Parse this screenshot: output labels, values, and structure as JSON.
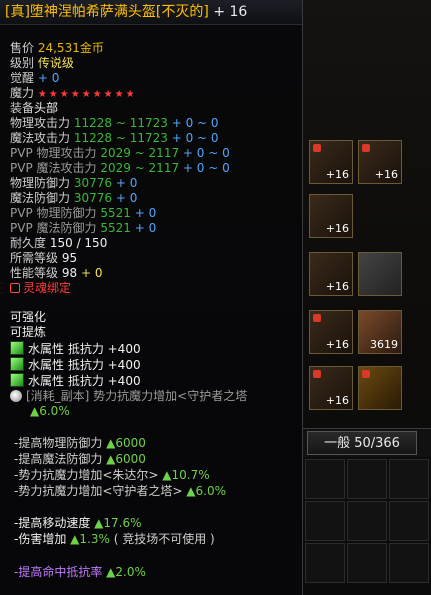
{
  "item": {
    "name": "[真]堕神涅帕希萨满头盔[不灭的]",
    "enhance": "+ 16",
    "price_label": "售价",
    "price": "24,531金币",
    "grade_label": "级别",
    "grade": "传说级",
    "awaken_label": "觉醒",
    "awaken": "+ 0",
    "magic_label": "魔力",
    "magic_stars": "★★★★★★★★★",
    "slot_label": "装备",
    "slot": "头部",
    "stats": [
      {
        "label": "物理攻击力",
        "value": "11228 ~ 11723",
        "bonus": "+ 0 ~ 0"
      },
      {
        "label": "魔法攻击力",
        "value": "11228 ~ 11723",
        "bonus": "+ 0 ~ 0"
      },
      {
        "label": "PVP 物理攻击力",
        "value": "2029 ~ 2117",
        "bonus": "+ 0 ~ 0"
      },
      {
        "label": "PVP 魔法攻击力",
        "value": "2029 ~ 2117",
        "bonus": "+ 0 ~ 0"
      },
      {
        "label": "物理防御力",
        "value": "30776",
        "bonus": "+ 0"
      },
      {
        "label": "魔法防御力",
        "value": "30776",
        "bonus": "+ 0"
      },
      {
        "label": "PVP 物理防御力",
        "value": "5521",
        "bonus": "+ 0"
      },
      {
        "label": "PVP 魔法防御力",
        "value": "5521",
        "bonus": "+ 0"
      }
    ],
    "durability_label": "耐久度",
    "durability": "150 / 150",
    "req_level_label": "所需等级",
    "req_level": "95",
    "perf_level_label": "性能等级",
    "perf_level": "98",
    "perf_bonus": "+ 0",
    "soulbound": "灵魂绑定",
    "enhanceable": "可强化",
    "refinable": "可提炼",
    "resists": [
      "水属性 抵抗力 +400",
      "水属性 抵抗力 +400",
      "水属性 抵抗力 +400"
    ],
    "dungeon_line": "[消耗_副本] 势力抗魔力增加<守护者之塔",
    "dungeon_value": "▲6.0%",
    "options": [
      {
        "text": "-提高物理防御力",
        "value": "▲6000"
      },
      {
        "text": "-提高魔法防御力",
        "value": "▲6000"
      },
      {
        "text": "-势力抗魔力增加<朱达尔>",
        "value": "▲10.7%"
      },
      {
        "text": "-势力抗魔力增加<守护者之塔>",
        "value": "▲6.0%"
      },
      {
        "text": "-提高移动速度",
        "value": "▲17.6%"
      },
      {
        "text": "-伤害增加",
        "value": "▲1.3%",
        "note": "( 竞技场不可使用 )"
      },
      {
        "text": "-提高命中抵抗率",
        "value": "▲2.0%"
      }
    ]
  },
  "inventory": {
    "tab_label": "一般 50/366",
    "slot_counts": [
      "+16",
      "+16",
      "+16",
      "+16",
      "+16",
      "3619",
      "+16"
    ]
  },
  "colors": {
    "title": "#ffc000",
    "gold": "#e6b800",
    "green": "#6fd14a",
    "blue": "#4fa6ff",
    "purple": "#c07aff",
    "red": "#ff3a3a"
  }
}
